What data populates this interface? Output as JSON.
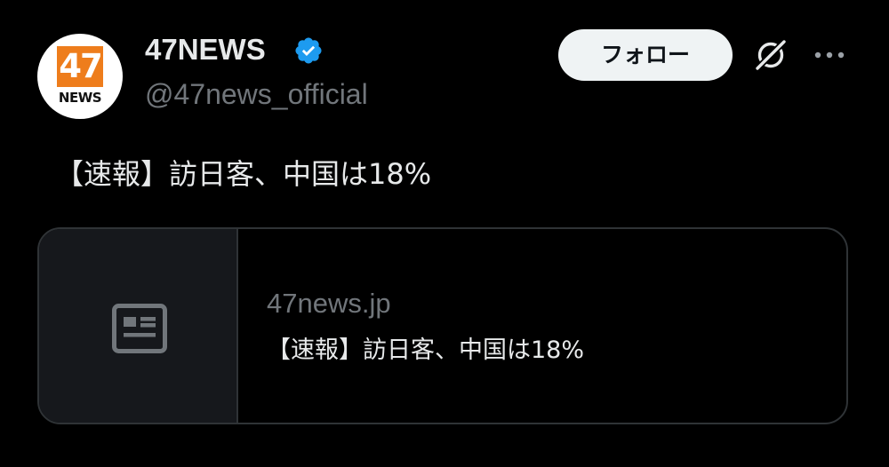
{
  "author": {
    "avatar_logo_number": "47",
    "avatar_logo_word": "NEWS",
    "display_name": "47NEWS",
    "handle": "@47news_official",
    "verified": true
  },
  "actions": {
    "follow_label": "フォロー"
  },
  "icons": {
    "verified": "verified-badge-icon",
    "grok": "grok-icon",
    "more": "more-options-icon",
    "card_placeholder": "article-placeholder-icon"
  },
  "tweet": {
    "text": "【速報】訪日客、中国は18%"
  },
  "card": {
    "domain": "47news.jp",
    "title": "【速報】訪日客、中国は18%"
  },
  "colors": {
    "background": "#000000",
    "primary_text": "#e7e9ea",
    "secondary_text": "#71767b",
    "verified_blue": "#1d9bf0",
    "logo_orange": "#ee7d1c",
    "border": "#2f3336"
  }
}
